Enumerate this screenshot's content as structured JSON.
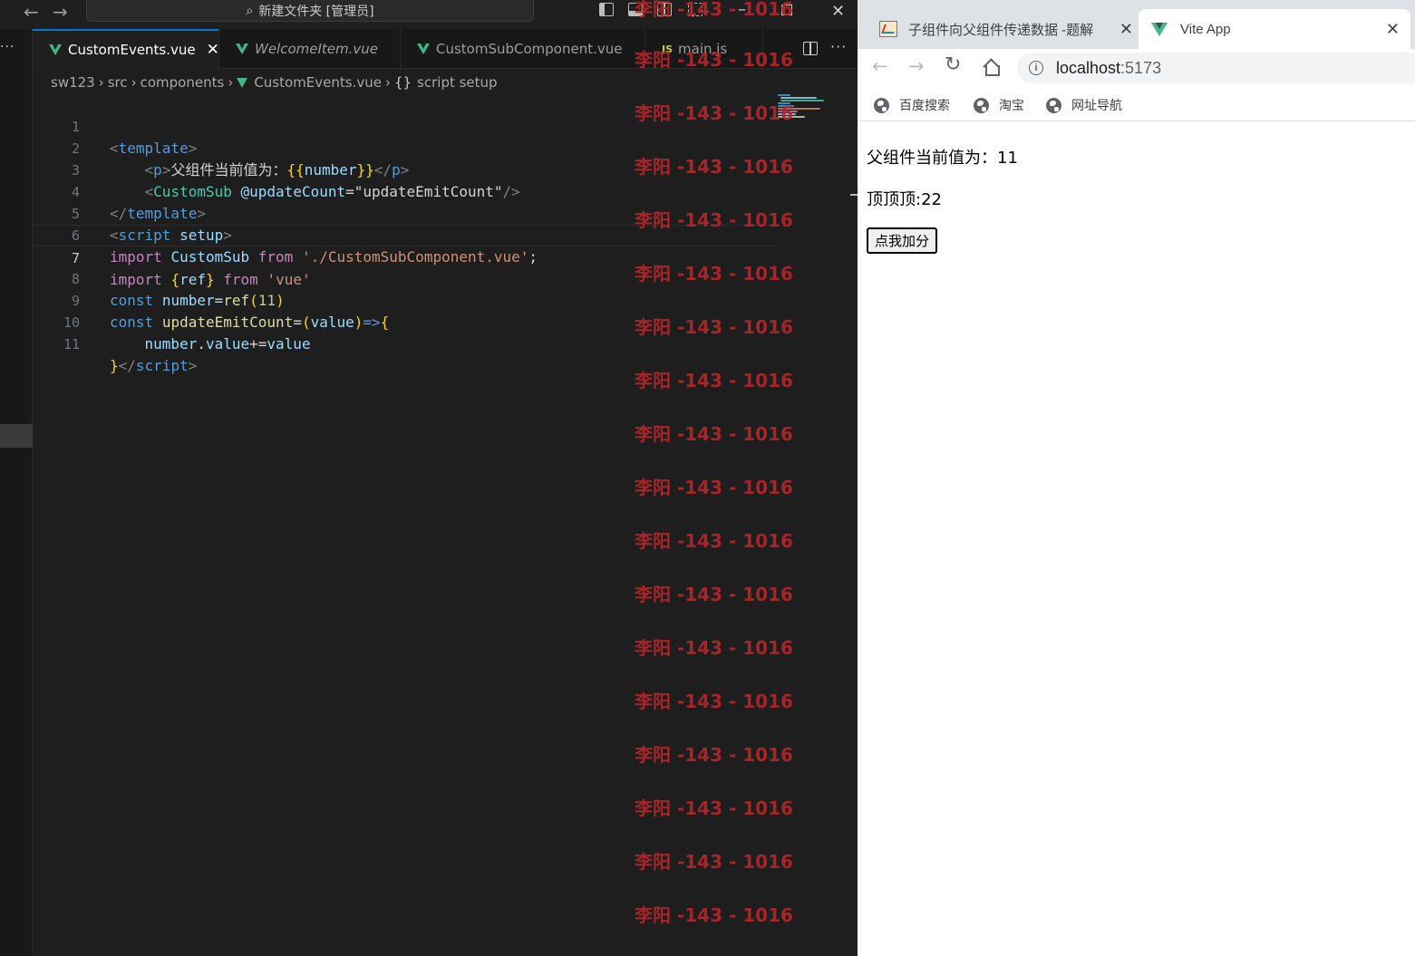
{
  "vscode": {
    "window_title": "新建文件夹 [管理员]",
    "tabs": [
      {
        "label": "CustomEvents.vue",
        "active": true,
        "icon": "vue-icon"
      },
      {
        "label": "WelcomeItem.vue",
        "active": false,
        "icon": "vue-icon",
        "italic": true
      },
      {
        "label": "CustomSubComponent.vue",
        "active": false,
        "icon": "vue-icon"
      },
      {
        "label": "main.js",
        "active": false,
        "icon": "js-icon",
        "icon_text": "JS"
      }
    ],
    "breadcrumb": [
      "sw123",
      "src",
      "components",
      "CustomEvents.vue",
      "script setup"
    ],
    "breadcrumb_symbol": "{}",
    "current_line": 7,
    "line_numbers": [
      "1",
      "2",
      "3",
      "4",
      "5",
      "6",
      "7",
      "8",
      "9",
      "10",
      "11"
    ],
    "code": {
      "l1": [
        "<",
        "template",
        ">"
      ],
      "l2": [
        "    ",
        "<",
        "p",
        ">",
        "父组件当前值为：",
        "{{",
        "number",
        "}}",
        "</",
        "p",
        ">"
      ],
      "l3": [
        "    ",
        "<",
        "CustomSub",
        " ",
        "@updateCount",
        "=",
        "\"updateEmitCount\"",
        "/>"
      ],
      "l4": [
        "</",
        "template",
        ">"
      ],
      "l5": [
        "<",
        "script",
        " ",
        "setup",
        ">"
      ],
      "l6": [
        "import",
        " ",
        "CustomSub",
        " ",
        "from",
        " ",
        "'./CustomSubComponent.vue'",
        ";"
      ],
      "l7": [
        "import",
        " ",
        "{",
        "ref",
        "}",
        " ",
        "from",
        " ",
        "'vue'"
      ],
      "l8": [
        "const",
        " ",
        "number",
        "=",
        "ref",
        "(",
        "11",
        ")"
      ],
      "l9": [
        "const",
        " ",
        "updateEmitCount",
        "=",
        "(",
        "value",
        ")",
        "=>",
        "{"
      ],
      "l10": [
        "    ",
        "number",
        ".",
        "value",
        "+=",
        "value"
      ],
      "l11": [
        "}",
        "</",
        "script",
        ">"
      ]
    },
    "watermark_text": "李阳 -143 - 1016",
    "colors": {
      "accent": "#0078d4",
      "vue_green": "#41b883",
      "watermark": "#b3262a"
    }
  },
  "browser": {
    "tabs": [
      {
        "title": "子组件向父组件传递数据 -题解",
        "active": false
      },
      {
        "title": "Vite App",
        "active": true
      }
    ],
    "url_host": "localhost",
    "url_port": ":5173",
    "bookmarks": [
      "百度搜索",
      "淘宝",
      "网址导航"
    ],
    "page": {
      "parent_label": "父组件当前值为：",
      "parent_value": "11",
      "child_label": "顶顶顶:",
      "child_value": "22",
      "button_label": "点我加分"
    }
  }
}
